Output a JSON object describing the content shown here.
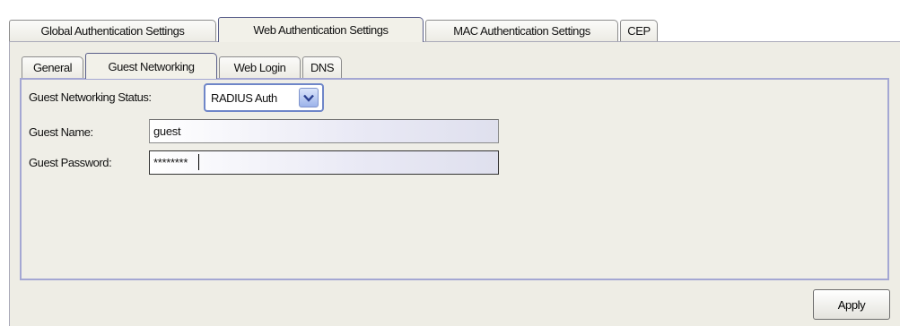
{
  "outer_tabs": [
    {
      "label": "Global Authentication Settings"
    },
    {
      "label": "Web Authentication Settings"
    },
    {
      "label": "MAC Authentication Settings"
    },
    {
      "label": "CEP"
    }
  ],
  "outer_active": "Web Authentication Settings",
  "inner_tabs": [
    {
      "label": "General"
    },
    {
      "label": "Guest Networking"
    },
    {
      "label": "Web Login"
    },
    {
      "label": "DNS"
    }
  ],
  "inner_active": "Guest Networking",
  "form": {
    "status_label": "Guest Networking Status:",
    "status_value": "RADIUS Auth",
    "name_label": "Guest Name:",
    "name_value": "guest",
    "password_label": "Guest Password:",
    "password_value": "********"
  },
  "buttons": {
    "apply_label": "Apply"
  },
  "colors": {
    "active_tab_border": "#5a5f8a",
    "panel_border": "#a4a7d3",
    "dropdown_accent": "#6f86c8"
  },
  "icons": {
    "dropdown": "chevron-down-icon"
  }
}
